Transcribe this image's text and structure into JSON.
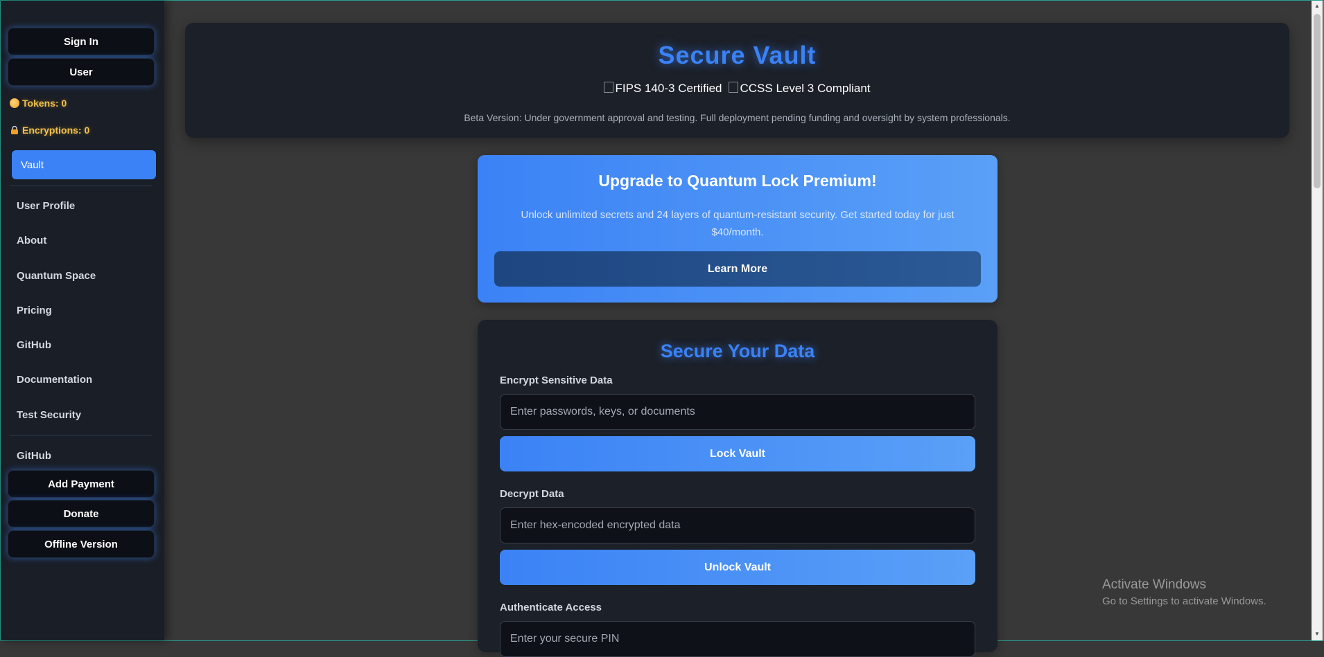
{
  "sidebar": {
    "sign_in": "Sign In",
    "user": "User",
    "tokens": "Tokens: 0",
    "encryptions": "Encryptions: 0",
    "active_item": "Vault",
    "nav": [
      "User Profile",
      "About",
      "Quantum Space",
      "Pricing",
      "GitHub",
      "Documentation",
      "Test Security"
    ],
    "github_link": "GitHub",
    "add_payment": "Add Payment",
    "donate": "Donate",
    "offline_version": "Offline Version"
  },
  "header": {
    "title": "Secure Vault",
    "badge_fips": "FIPS 140-3 Certified",
    "badge_ccss": "CCSS Level 3 Compliant",
    "beta_note": "Beta Version: Under government approval and testing. Full deployment pending funding and oversight by system professionals."
  },
  "premium": {
    "title": "Upgrade to Quantum Lock Premium!",
    "description": "Unlock unlimited secrets and 24 layers of quantum-resistant security. Get started today for just $40/month.",
    "button": "Learn More"
  },
  "secure": {
    "title": "Secure Your Data",
    "encrypt_label": "Encrypt Sensitive Data",
    "encrypt_placeholder": "Enter passwords, keys, or documents",
    "lock_button": "Lock Vault",
    "decrypt_label": "Decrypt Data",
    "decrypt_placeholder": "Enter hex-encoded encrypted data",
    "unlock_button": "Unlock Vault",
    "auth_label": "Authenticate Access",
    "auth_placeholder": "Enter your secure PIN"
  },
  "watermark": {
    "line1": "Activate Windows",
    "line2": "Go to Settings to activate Windows."
  },
  "colors": {
    "accent": "#3b82f6",
    "sidebar_bg": "#1a1e26",
    "page_bg": "#383838",
    "card_bg": "#1c2028",
    "token_gold": "#f0c14b"
  }
}
